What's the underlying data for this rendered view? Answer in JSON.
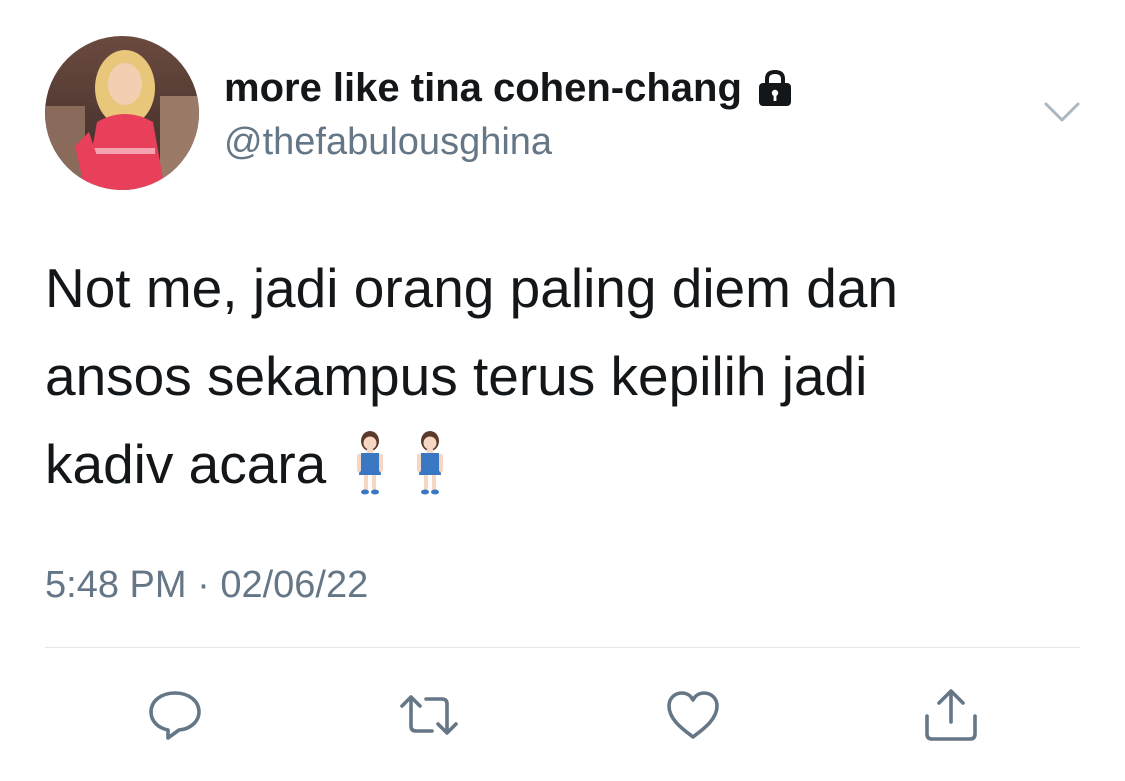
{
  "user": {
    "display_name": "more like tina cohen-chang",
    "handle": "@thefabulousghina",
    "protected_icon": "lock-icon",
    "avatar_icon": "profile-photo"
  },
  "tweet": {
    "lines": [
      "Not me, jadi orang paling diem dan",
      "ansos sekampus terus kepilih jadi",
      "kadiv acara"
    ],
    "emojis": [
      "woman-standing-emoji",
      "woman-standing-emoji"
    ],
    "time": "5:48 PM",
    "separator": "·",
    "date": "02/06/22"
  },
  "actions": [
    {
      "name": "reply",
      "icon": "speech-bubble-icon"
    },
    {
      "name": "retweet",
      "icon": "retweet-icon"
    },
    {
      "name": "like",
      "icon": "heart-icon"
    },
    {
      "name": "share",
      "icon": "share-icon"
    }
  ],
  "colors": {
    "text": "#14171a",
    "secondary": "#657786",
    "divider": "#e1e8ed",
    "avatar_dress": "#e8405a"
  }
}
